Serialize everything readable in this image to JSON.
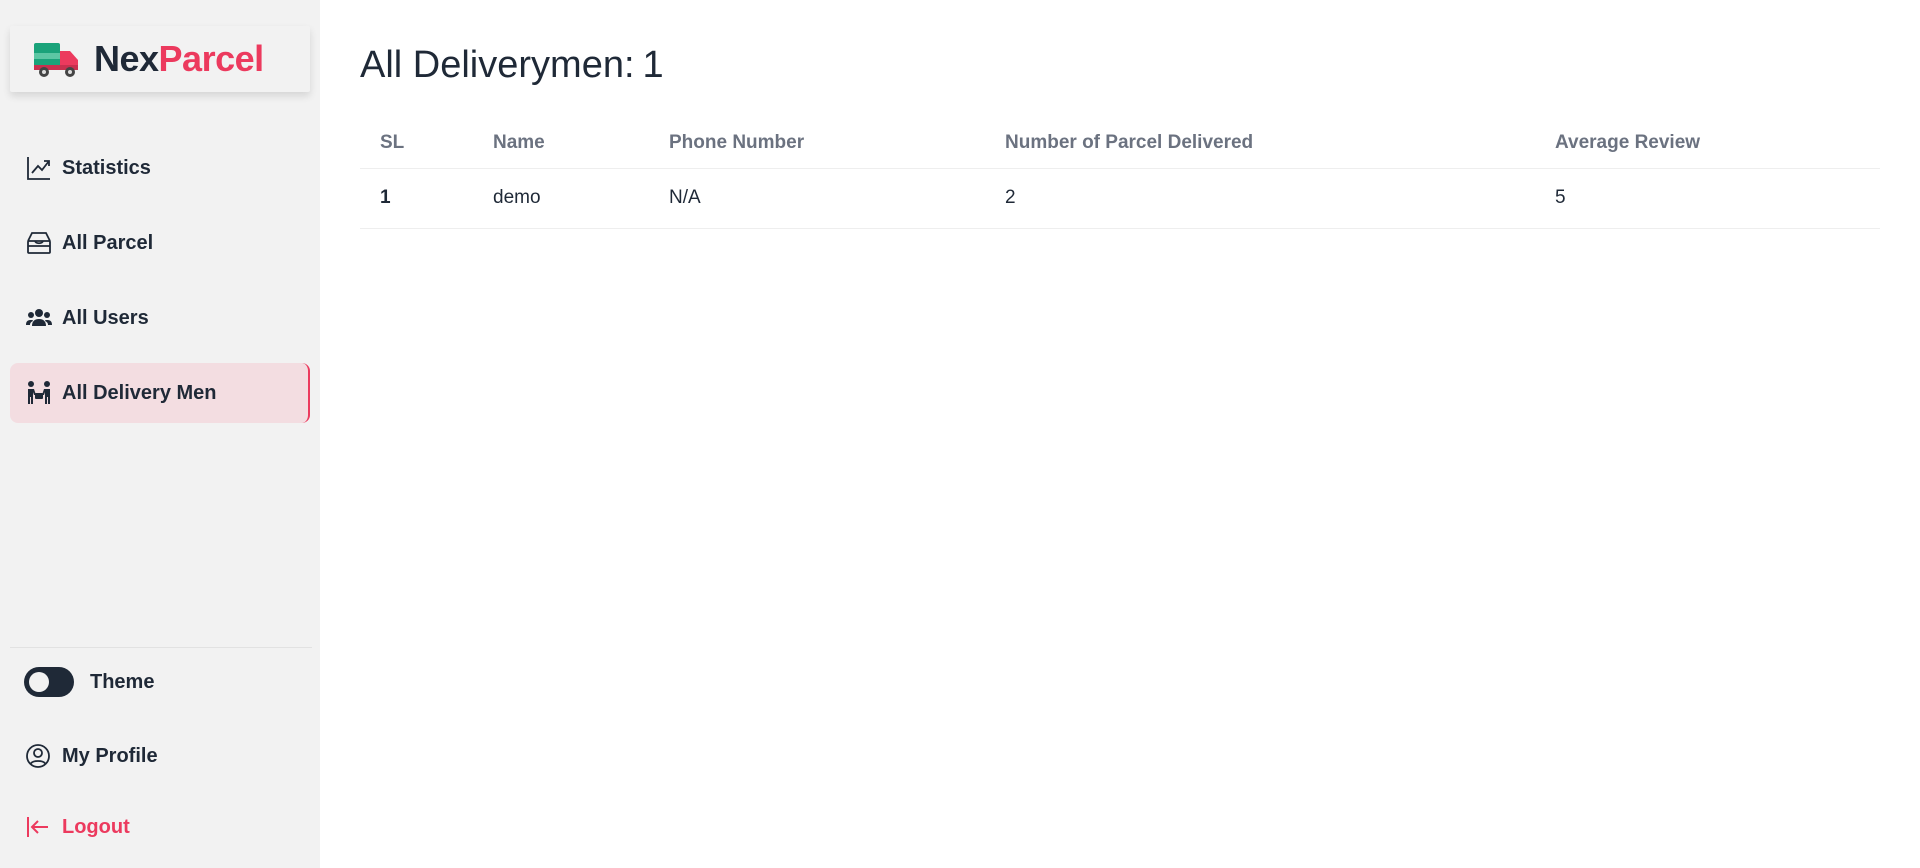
{
  "brand": {
    "part1": "Nex",
    "part2": "Parcel",
    "accent_color": "#ec3a5e",
    "truck_colors": [
      "#1aa37a",
      "#ec3a5e"
    ]
  },
  "sidebar": {
    "items": [
      {
        "label": "Statistics",
        "icon": "chart-line-icon",
        "active": false
      },
      {
        "label": "All Parcel",
        "icon": "parcel-box-icon",
        "active": false
      },
      {
        "label": "All Users",
        "icon": "users-icon",
        "active": false
      },
      {
        "label": "All Delivery Men",
        "icon": "delivery-men-icon",
        "active": true
      }
    ],
    "theme_label": "Theme",
    "profile_label": "My Profile",
    "logout_label": "Logout"
  },
  "main": {
    "title": "All Deliverymen:",
    "count": "1",
    "table": {
      "headers": [
        "SL",
        "Name",
        "Phone Number",
        "Number of Parcel Delivered",
        "Average Review"
      ],
      "rows": [
        [
          "1",
          "demo",
          "N/A",
          "2",
          "5"
        ]
      ]
    }
  }
}
